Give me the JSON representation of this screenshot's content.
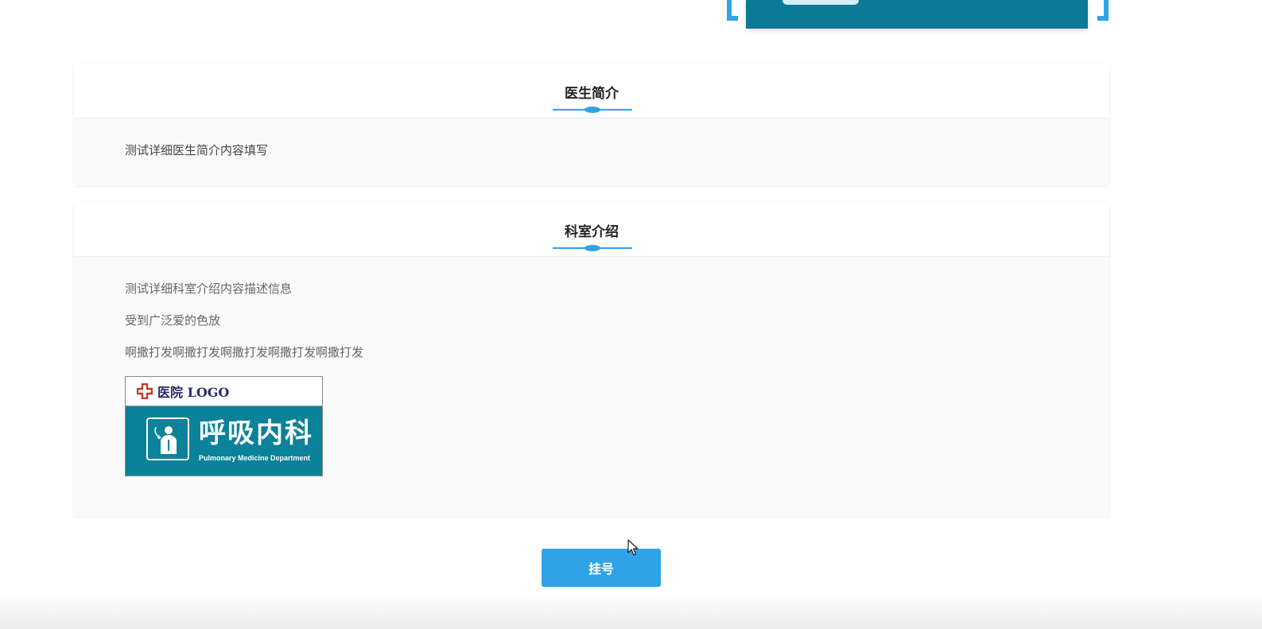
{
  "doctor_intro": {
    "title": "医生简介",
    "lines": [
      "测试详细医生简介内容填写"
    ]
  },
  "department_intro": {
    "title": "科室介绍",
    "lines": [
      "测试详细科室介绍内容描述信息",
      "受到广泛爱的色放",
      "啊撒打发啊撒打发啊撒打发啊撒打发啊撒打发"
    ],
    "sign": {
      "logo_text": "医院 LOGO",
      "name": "呼吸内科",
      "english_name": "Pulmonary Medicine Department"
    }
  },
  "actions": {
    "register_label": "挂号"
  },
  "colors": {
    "accent": "#2fa3e6",
    "sign_teal": "#0a8299"
  }
}
